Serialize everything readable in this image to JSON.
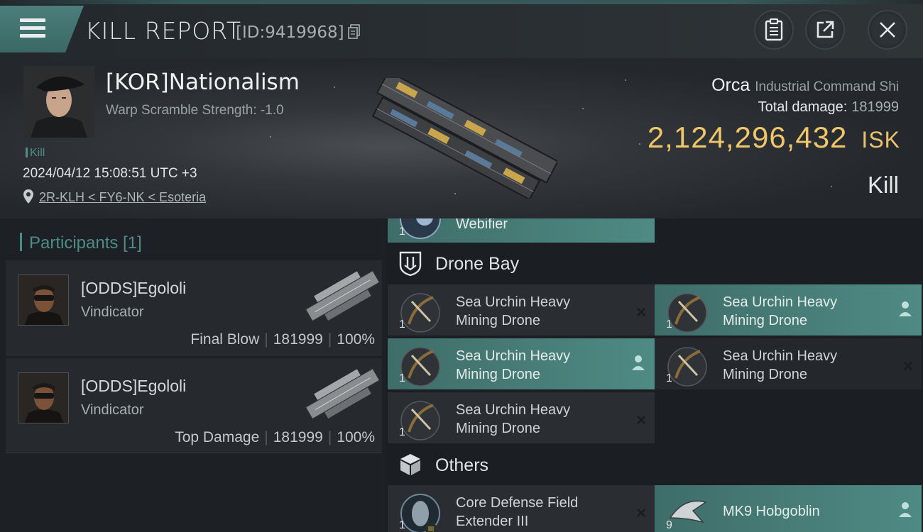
{
  "header": {
    "title": "KILL REPORT",
    "id_label": "[ID:9419968]",
    "buttons": [
      {
        "name": "clipboard-icon"
      },
      {
        "name": "share-icon"
      },
      {
        "name": "close-icon"
      }
    ]
  },
  "victim": {
    "name": "[KOR]Nationalism",
    "subtitle": "Warp Scramble Strength: -1.0",
    "tag": "Kill",
    "datetime": "2024/04/12 15:08:51 UTC +3",
    "location": "2R-KLH < FY6-NK < Esoteria"
  },
  "ship": {
    "name": "Orca",
    "class": "Industrial Command Shi",
    "total_damage_label": "Total damage:",
    "total_damage": "181999",
    "isk_value": "2,124,296,432",
    "isk_unit": "ISK",
    "result": "Kill"
  },
  "participants": {
    "title": "Participants [1]",
    "list": [
      {
        "name": "[ODDS]Egololi",
        "ship": "Vindicator",
        "role": "Final Blow",
        "damage": "181999",
        "percent": "100%"
      },
      {
        "name": "[ODDS]Egololi",
        "ship": "Vindicator",
        "role": "Top Damage",
        "damage": "181999",
        "percent": "100%"
      }
    ]
  },
  "items": {
    "top_item": {
      "name": "Webifier",
      "qty": "1"
    },
    "drone_bay": {
      "title": "Drone Bay",
      "list": [
        {
          "line1": "Sea Urchin Heavy",
          "line2": "Mining Drone",
          "qty": "1",
          "status": "×"
        },
        {
          "line1": "Sea Urchin Heavy",
          "line2": "Mining Drone",
          "qty": "1",
          "status": "dropped"
        },
        {
          "line1": "Sea Urchin Heavy",
          "line2": "Mining Drone",
          "qty": "1",
          "status": "dropped"
        },
        {
          "line1": "Sea Urchin Heavy",
          "line2": "Mining Drone",
          "qty": "1",
          "status": "×"
        },
        {
          "line1": "Sea Urchin Heavy",
          "line2": "Mining Drone",
          "qty": "1",
          "status": "×"
        }
      ]
    },
    "others": {
      "title": "Others",
      "list": [
        {
          "line1": "Core Defense Field",
          "line2": "Extender III",
          "qty": "1",
          "status": "×"
        },
        {
          "line1": "MK9  Hobgoblin",
          "line2": "",
          "qty": "9",
          "status": "dropped"
        }
      ]
    }
  },
  "colors": {
    "accent_teal": "#4f8a84",
    "isk_gold": "#f0c66a",
    "panel_dark": "#1d2024"
  }
}
